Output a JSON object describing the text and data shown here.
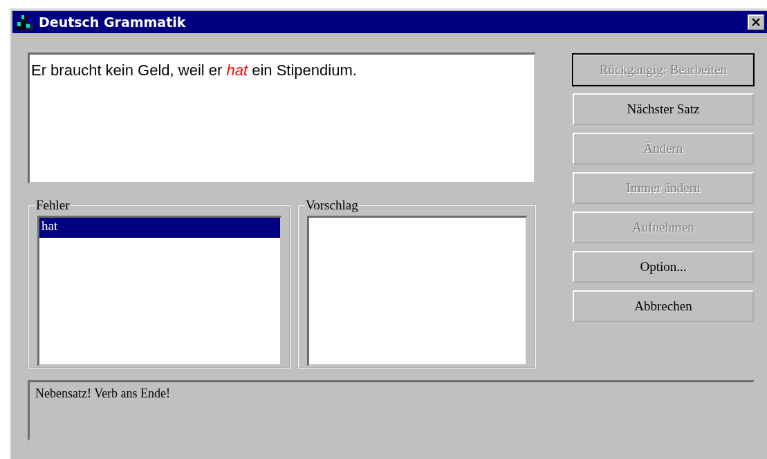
{
  "window": {
    "title": "Deutsch Grammatik"
  },
  "sentence": [
    {
      "text": "Er braucht kein Geld, weil er ",
      "error": false
    },
    {
      "text": "hat",
      "error": true
    },
    {
      "text": " ein Stipendium.",
      "error": false
    }
  ],
  "errors": {
    "legend": "Fehler",
    "items": [
      {
        "text": "hat",
        "selected": true
      }
    ]
  },
  "suggestions": {
    "legend": "Vorschlag"
  },
  "buttons": [
    {
      "label": "Rückgangig: Bearbeiten",
      "disabled": true,
      "default": true
    },
    {
      "label": "Nächster Satz",
      "disabled": false,
      "default": false
    },
    {
      "label": "Ändern",
      "disabled": true,
      "default": false
    },
    {
      "label": "Immer ändern",
      "disabled": true,
      "default": false
    },
    {
      "label": "Aufnehmen",
      "disabled": true,
      "default": false
    },
    {
      "label": "Option...",
      "disabled": false,
      "default": false
    },
    {
      "label": "Abbrechen",
      "disabled": false,
      "default": false
    }
  ],
  "message": "Nebensatz! Verb ans Ende!"
}
